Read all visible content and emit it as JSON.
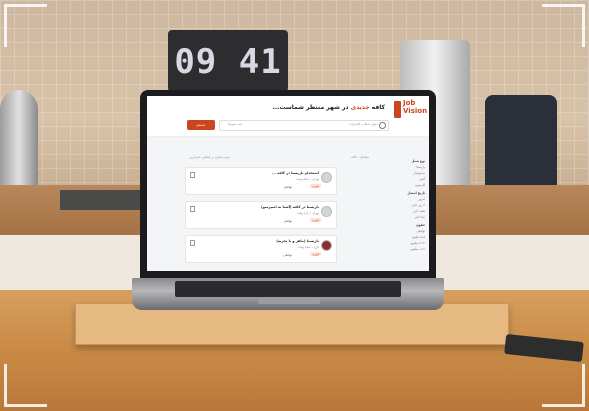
{
  "scene": {
    "clock_text": "09 41",
    "colors": {
      "accent": "#c9461e",
      "tabletop": "#d79f5e",
      "laptop": "#1c1c1e"
    }
  },
  "screen": {
    "logo": {
      "line1": "Job",
      "line2": "Vision"
    },
    "headline_part1": "کافه ",
    "headline_accent": "جدیدی",
    "headline_part2": " در شهر منتظر شماست...",
    "search": {
      "placeholder": "عنوان شغلی، کلیدواژه...",
      "city": "همه شهرها",
      "button": "جستجو"
    },
    "breadcrumb": "مشاغل • کافه",
    "sort_label": "مرتب سازی بر اساس: جدیدترین",
    "sidebar": {
      "sections": [
        {
          "title": "نوع شغل",
          "items": [
            "باریستا",
            "صندوقدار",
            "آشپز",
            "گارسون"
          ]
        },
        {
          "title": "تاریخ انتشار",
          "items": [
            "امروز",
            "۳ روز اخیر",
            "هفته اخیر",
            "ماه اخیر"
          ]
        },
        {
          "title": "حقوق",
          "items": [
            "توافقی",
            "۵-۸ میلیون",
            "۸-۱۲ میلیون",
            "۱۲+ میلیون"
          ]
        }
      ]
    },
    "cards": [
      {
        "title": "استخدام باریستا در کافه ...",
        "meta": "تهران • تمام وقت",
        "salary": "توافقی",
        "badge": "فوری"
      },
      {
        "title": "باریستا در کافه (آشنا به اسپرسو)",
        "meta": "تهران • پاره وقت",
        "salary": "توافقی",
        "badge": "فوری"
      },
      {
        "title": "باریستا (ماهر و با تجربه)",
        "meta": "کرج • تمام وقت",
        "salary": "توافقی",
        "badge": "فوری"
      }
    ]
  }
}
